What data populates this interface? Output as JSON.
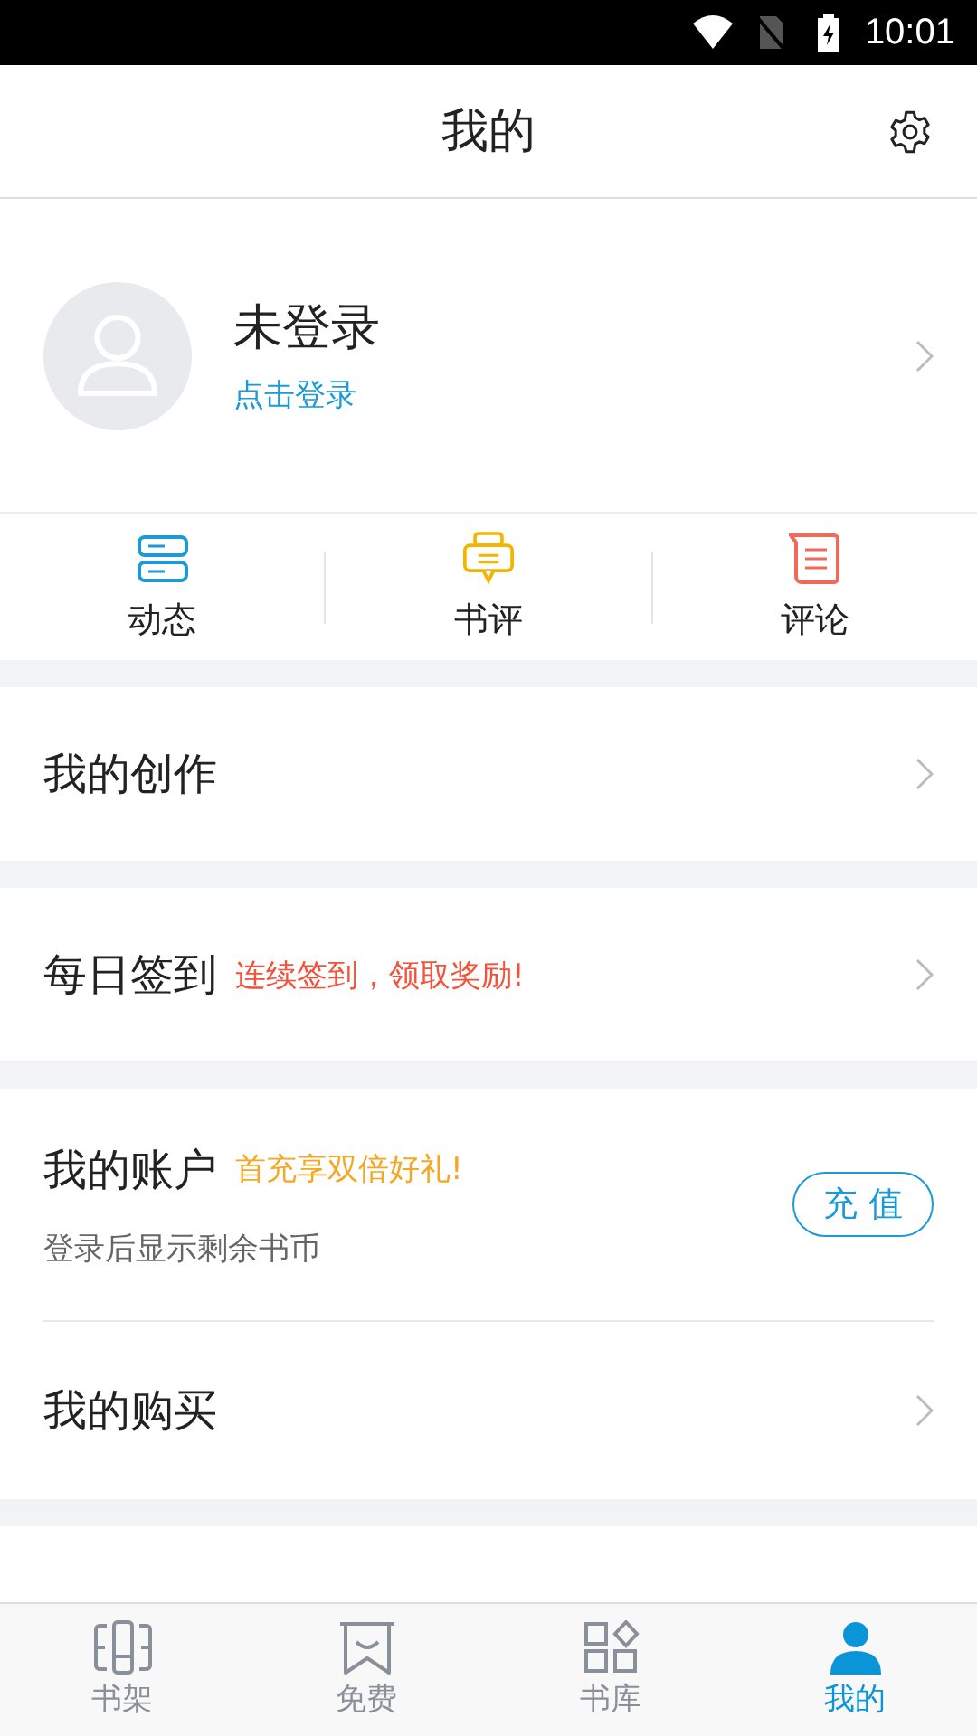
{
  "status_bar": {
    "time": "10:01"
  },
  "header": {
    "title": "我的"
  },
  "profile": {
    "name": "未登录",
    "action": "点击登录"
  },
  "shortcuts": [
    {
      "kind": "feed",
      "label": "动态"
    },
    {
      "kind": "review",
      "label": "书评"
    },
    {
      "kind": "comment",
      "label": "评论"
    }
  ],
  "groups": [
    [
      {
        "kind": "link",
        "title": "我的创作"
      }
    ],
    [
      {
        "kind": "link",
        "title": "每日签到",
        "note": "连续签到，领取奖励!",
        "color": "#f4523b"
      }
    ],
    [
      {
        "kind": "account",
        "title": "我的账户",
        "note": "首充享双倍好礼!",
        "color": "#f5a623",
        "sub": "登录后显示剩余书币",
        "button": "充 值"
      },
      {
        "kind": "link",
        "title": "我的购买"
      }
    ],
    [
      {
        "kind": "blank"
      }
    ]
  ],
  "tab_bar": [
    {
      "kind": "shelf",
      "label": "书架",
      "selected": false
    },
    {
      "kind": "free",
      "label": "免费",
      "selected": false
    },
    {
      "kind": "library",
      "label": "书库",
      "selected": false
    },
    {
      "kind": "me",
      "label": "我的",
      "selected": true
    }
  ]
}
